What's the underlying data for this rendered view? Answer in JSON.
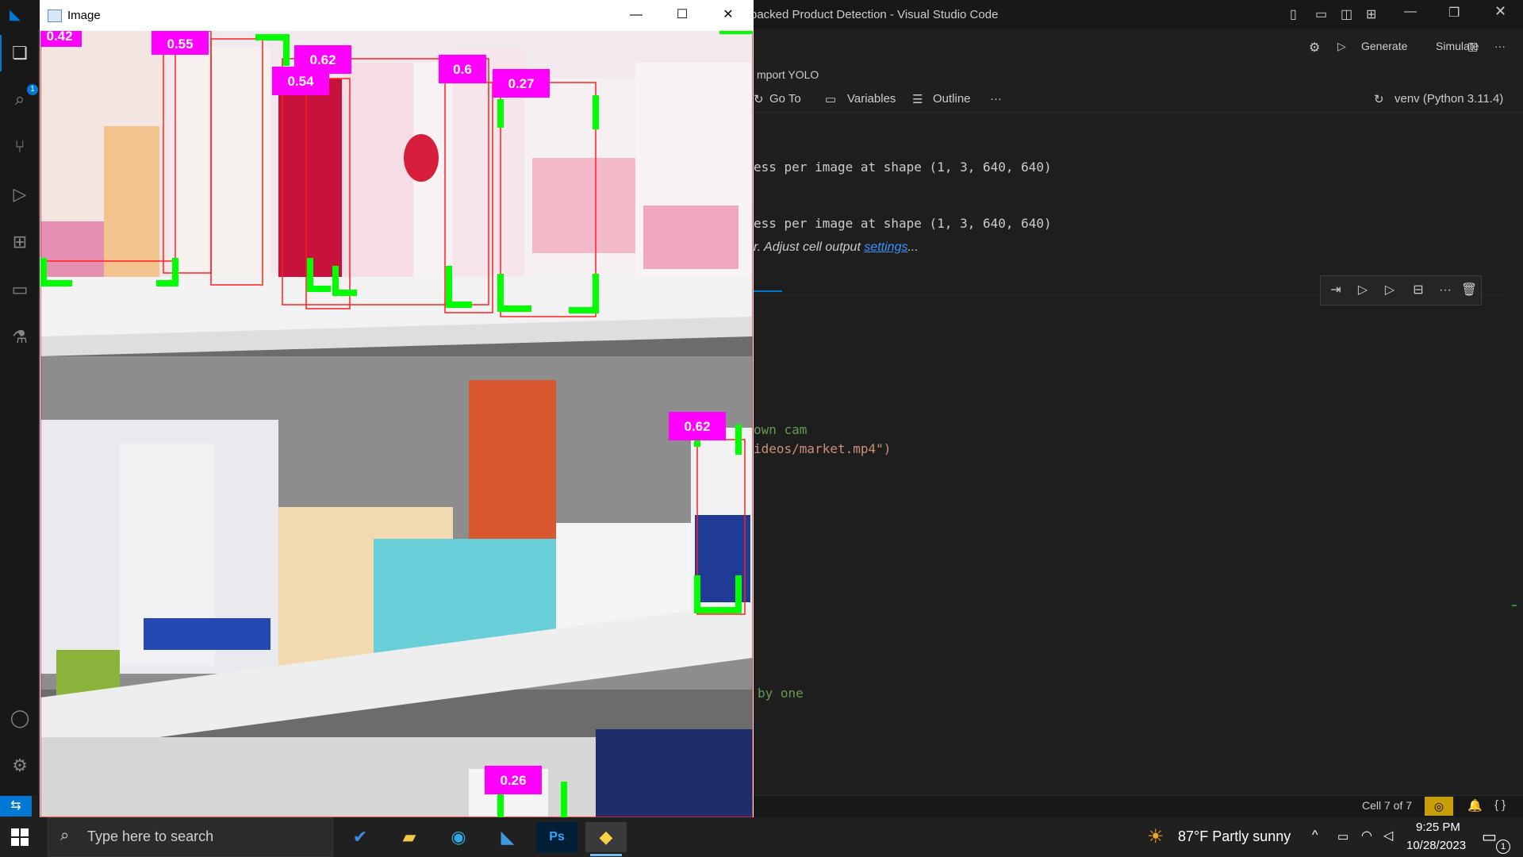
{
  "vscode": {
    "title": "packed Product Detection - Visual Studio Code",
    "toolbar": {
      "generate": "Generate",
      "simulate": "Simulate"
    },
    "breadcrumb": "mport YOLO",
    "nb": {
      "goto": "Go To",
      "variables": "Variables",
      "outline": "Outline",
      "more": "···",
      "kernel": "venv (Python 3.11.4)"
    },
    "output": {
      "line1": "ess per image at shape (1, 3, 640, 640)",
      "line2": "ess per image at shape (1, 3, 640, 640)",
      "trunc_prefix": "r. Adjust cell output ",
      "trunc_link": "settings",
      "trunc_suffix": "..."
    },
    "code": {
      "comment1": "own cam",
      "path_line": "ideos/market.mp4\")",
      "comment2": "by one"
    },
    "status": {
      "cell_count": "Cell 7 of 7",
      "activity_badge": "1"
    }
  },
  "image_window": {
    "title": "Image",
    "detections": [
      "0.42",
      "0.55",
      "0.62",
      "0.54",
      "0.6",
      "0.27",
      "0.62",
      "0.26"
    ]
  },
  "taskbar": {
    "search_placeholder": "Type here to search",
    "weather": "87°F  Partly sunny",
    "time": "9:25 PM",
    "date": "10/28/2023",
    "notifications": "1"
  },
  "colors": {
    "label_bg": "#ff00ff",
    "box_corner": "#00ff00",
    "box_line": "#ff0000",
    "accent": "#0078d4"
  }
}
